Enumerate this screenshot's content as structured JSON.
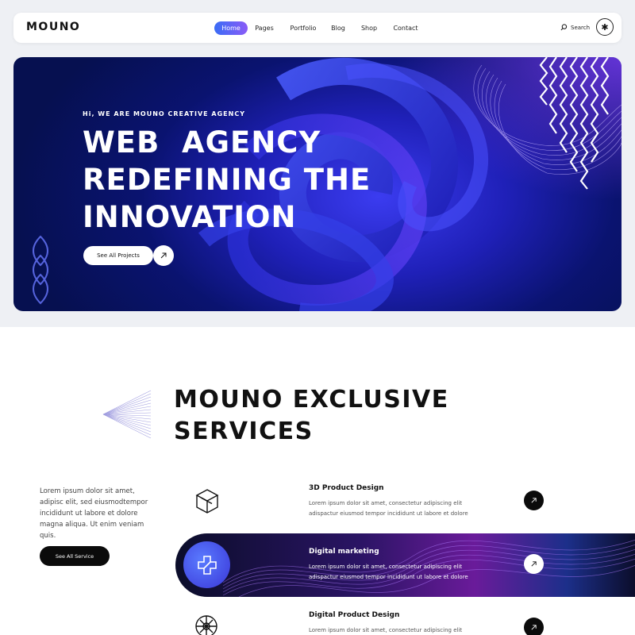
{
  "nav": {
    "logo": "MOUNO",
    "links": [
      {
        "label": "Home",
        "active": true
      },
      {
        "label": "Pages"
      },
      {
        "label": "Portfolio"
      },
      {
        "label": "Blog"
      },
      {
        "label": "Shop"
      },
      {
        "label": "Contact"
      }
    ],
    "search_label": "Search",
    "search_icon": "search-icon",
    "menu_icon": "asterisk-icon"
  },
  "hero": {
    "eyebrow": "Hi, WE ARE MOUNO CREATIVE AGENCY",
    "title_lines": [
      "WEB  AGENCY",
      "REDEFINING THE",
      "INNOVATION"
    ],
    "cta_label": "See All Projects",
    "cta_icon": "arrow-up-right-icon"
  },
  "services": {
    "title_lines": [
      "MOUNO EXCLUSIVE",
      "SERVICES"
    ],
    "description": "Lorem ipsum dolor sit amet, adipisc elit, sed eiusmodtempor incididunt ut labore et dolore magna aliqua. Ut enim veniam quis.",
    "cta_label": "See All Service",
    "items": [
      {
        "title": "3D Product Design",
        "text": "Lorem ipsum dolor sit amet, consectetur adipiscing elit adispactur eiusmod tempor incididunt ut labore et dolore",
        "icon": "cube-icon"
      },
      {
        "title": "Digital marketing",
        "text": "Lorem ipsum dolor sit amet, consectetur adipiscing elit adispactur eiusmod tempor incididunt ut labore et dolore",
        "icon": "plus-cross-icon"
      },
      {
        "title": "Digital Product Design",
        "text": "Lorem ipsum dolor sit amet, consectetur adipiscing elit adispactur eiusmod tempor incididunt ut labore et dolore",
        "icon": "compass-icon"
      }
    ]
  },
  "colors": {
    "accent_start": "#3a6cf5",
    "accent_end": "#8a5cf7",
    "hero_blue": "#1f20b8",
    "dark": "#0b0b0b"
  }
}
